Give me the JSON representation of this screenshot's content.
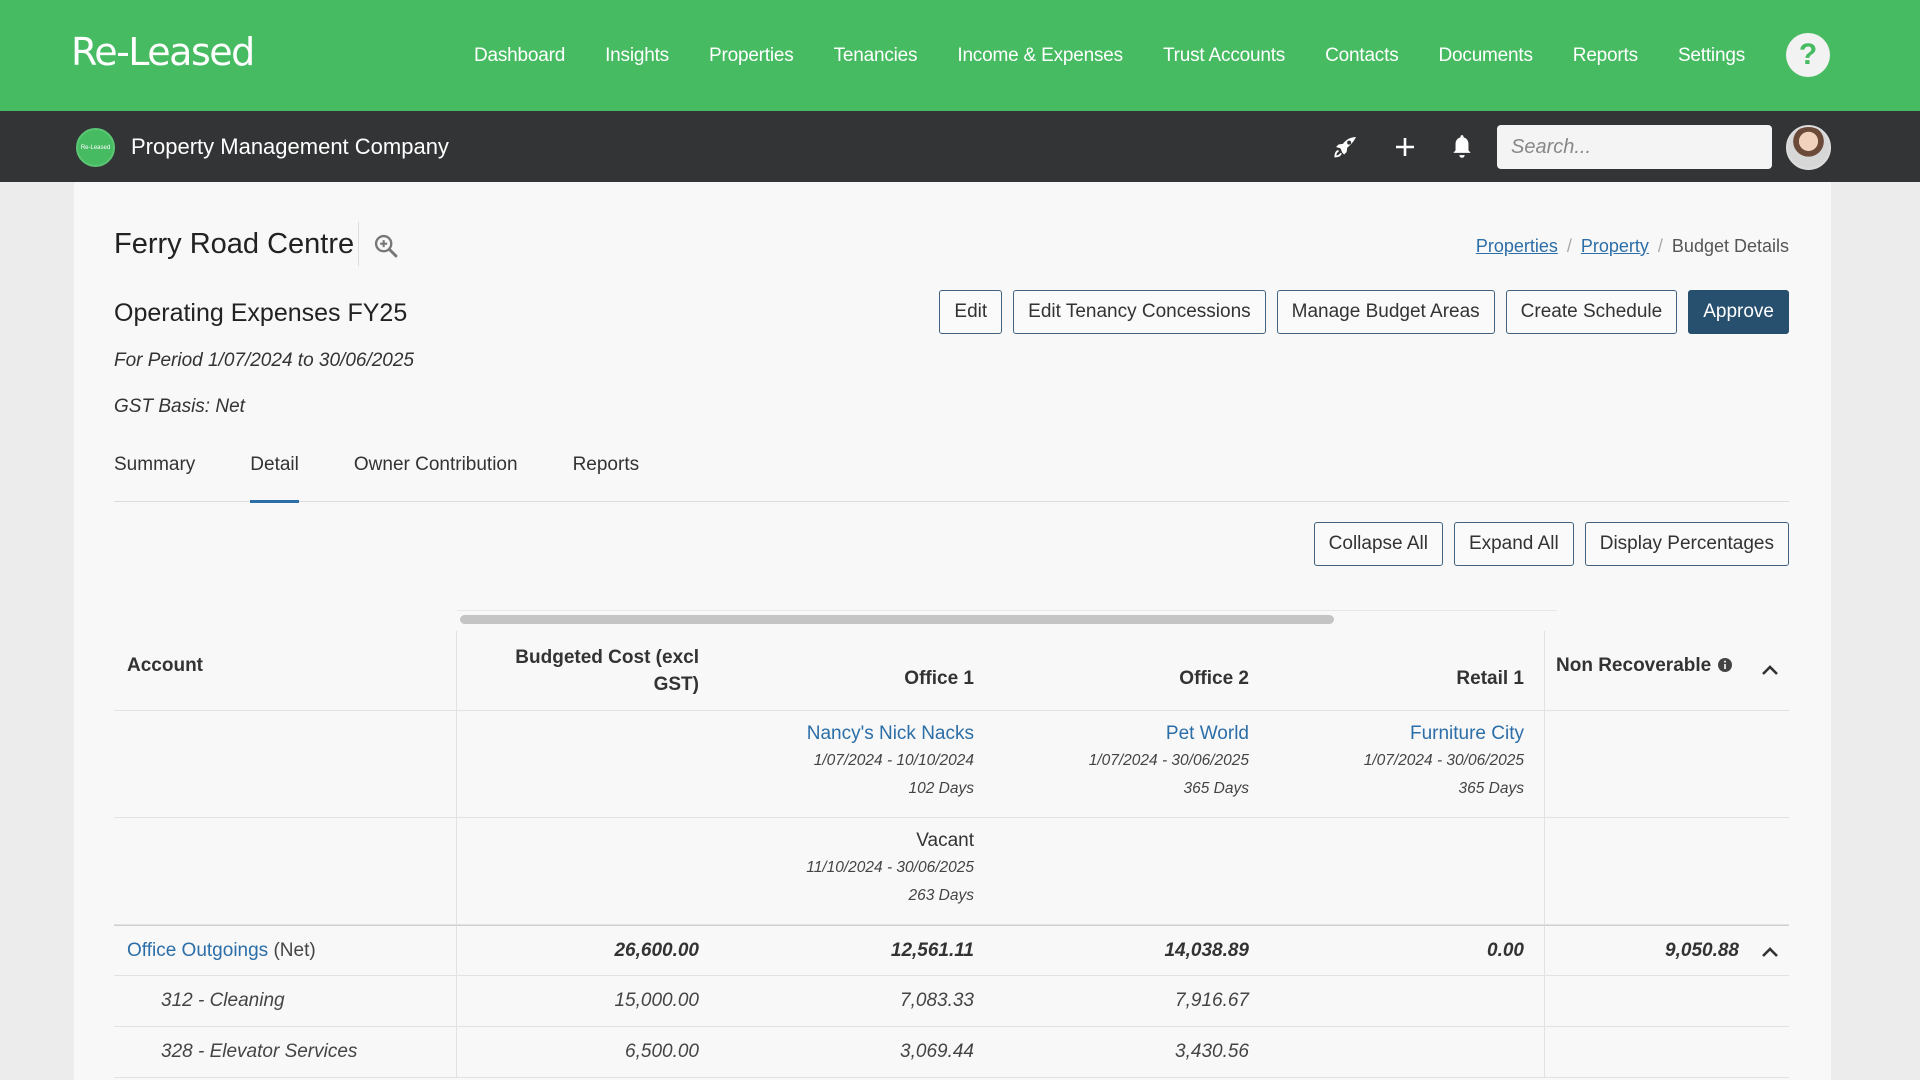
{
  "app": {
    "logo": "Re-Leased"
  },
  "nav": {
    "items": [
      "Dashboard",
      "Insights",
      "Properties",
      "Tenancies",
      "Income & Expenses",
      "Trust Accounts",
      "Contacts",
      "Documents",
      "Reports",
      "Settings"
    ],
    "help": "?"
  },
  "subbar": {
    "company_logo_text": "Re-Leased",
    "company_name": "Property Management Company",
    "search_placeholder": "Search..."
  },
  "page": {
    "title": "Ferry Road Centre",
    "breadcrumb": [
      "Properties",
      "Property",
      "Budget Details"
    ],
    "subtitle": "Operating Expenses FY25",
    "period": "For Period 1/07/2024 to 30/06/2025",
    "gst_basis": "GST Basis: Net",
    "actions": [
      "Edit",
      "Edit Tenancy Concessions",
      "Manage Budget Areas",
      "Create Schedule",
      "Approve"
    ],
    "tabs": [
      "Summary",
      "Detail",
      "Owner Contribution",
      "Reports"
    ],
    "active_tab": "Detail",
    "tools": [
      "Collapse All",
      "Expand All",
      "Display Percentages"
    ]
  },
  "table": {
    "headers": {
      "account": "Account",
      "budgeted_line1": "Budgeted Cost (excl",
      "budgeted_line2": "GST)",
      "office1": "Office 1",
      "office2": "Office 2",
      "retail1": "Retail 1",
      "non_recoverable": "Non Recoverable"
    },
    "tenancies": [
      {
        "name": "Nancy's Nick Nacks",
        "dates": "1/07/2024 - 10/10/2024",
        "days": "102 Days"
      },
      {
        "name": "Pet World",
        "dates": "1/07/2024 - 30/06/2025",
        "days": "365 Days"
      },
      {
        "name": "Furniture City",
        "dates": "1/07/2024 - 30/06/2025",
        "days": "365 Days"
      }
    ],
    "vacant": {
      "name": "Vacant",
      "dates": "11/10/2024 - 30/06/2025",
      "days": "263 Days"
    },
    "group": {
      "name": "Office Outgoings",
      "basis": "(Net)",
      "budgeted": "26,600.00",
      "office1": "12,561.11",
      "office2": "14,038.89",
      "retail1": "0.00",
      "non_recoverable": "9,050.88"
    },
    "rows": [
      {
        "account": "312 - Cleaning",
        "budgeted": "15,000.00",
        "office1": "7,083.33",
        "office2": "7,916.67"
      },
      {
        "account": "328 - Elevator Services",
        "budgeted": "6,500.00",
        "office1": "3,069.44",
        "office2": "3,430.56"
      }
    ]
  },
  "colors": {
    "brand_green": "#46bb61",
    "dark_bar": "#333435",
    "primary_button": "#27506f",
    "link": "#2c6ea7"
  }
}
